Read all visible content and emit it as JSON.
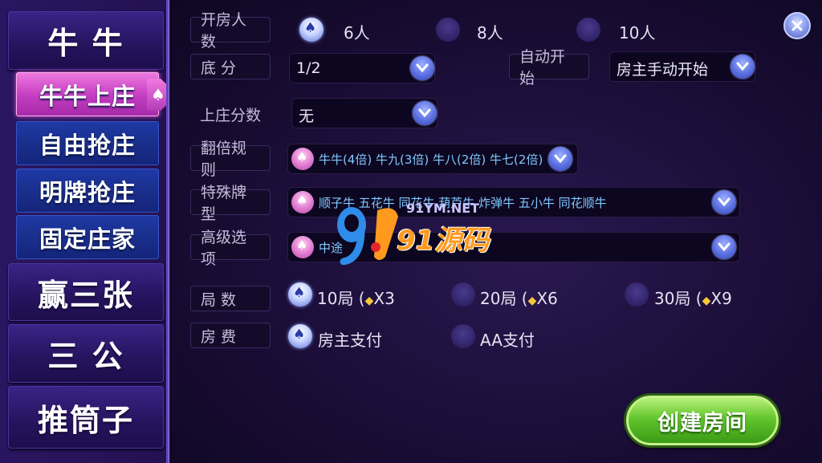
{
  "sidebar": {
    "games": [
      "牛  牛",
      "赢三张",
      "三  公",
      "推筒子"
    ],
    "modes": [
      "牛牛上庄",
      "自由抢庄",
      "明牌抢庄",
      "固定庄家"
    ]
  },
  "settings": {
    "players": {
      "label": "开房人数",
      "options": [
        "6人",
        "8人",
        "10人"
      ],
      "selected": "6人"
    },
    "base_score": {
      "label": "底        分",
      "value": "1/2"
    },
    "auto_start": {
      "label": "自动开始",
      "value": "房主手动开始"
    },
    "banker_score": {
      "label": "上庄分数",
      "value": "无"
    },
    "double_rule": {
      "label": "翻倍规则",
      "value": "牛牛(4倍) 牛九(3倍) 牛八(2倍) 牛七(2倍)"
    },
    "special_cards": {
      "label": "特殊牌型",
      "value": "顺子牛 五花牛 同花牛 葫芦牛 炸弹牛 五小牛 同花顺牛"
    },
    "advanced": {
      "label": "高级选项",
      "value": "中途"
    },
    "rounds": {
      "label": "局        数",
      "options": [
        "10局",
        "20局",
        "30局"
      ],
      "costs": [
        "X3",
        "X6",
        "X9"
      ],
      "selected": "10局"
    },
    "fee": {
      "label": "房        费",
      "options": [
        "房主支付",
        "AA支付"
      ],
      "selected": "房主支付"
    }
  },
  "buttons": {
    "create": "创建房间"
  },
  "watermark": {
    "site": "91YM.NET",
    "text": "91源码"
  },
  "colors": {
    "accent_pink": "#c23cc0",
    "accent_blue": "#1a2f8c",
    "create_green": "#62c62c"
  }
}
